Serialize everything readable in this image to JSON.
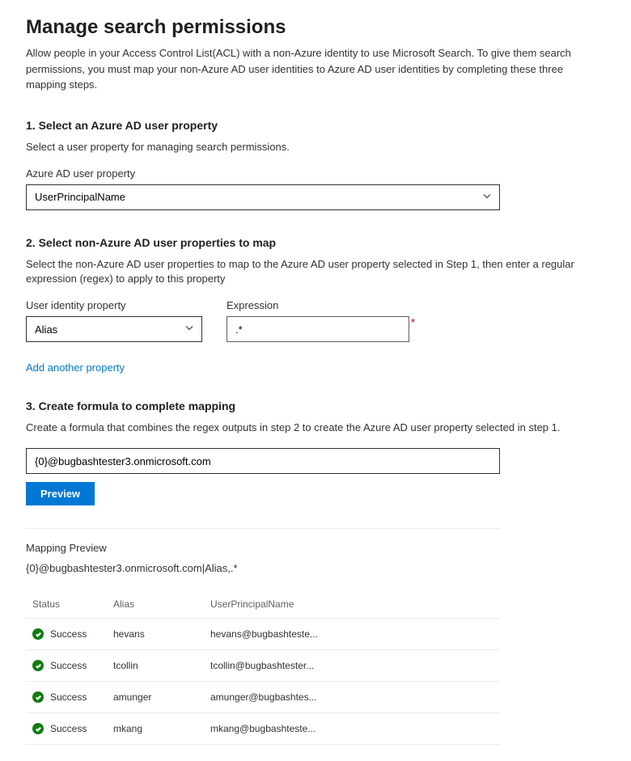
{
  "page": {
    "title": "Manage search permissions",
    "description": "Allow people in your Access Control List(ACL) with a non-Azure identity to use Microsoft Search. To give them search permissions, you must map your non-Azure AD user identities to Azure AD user identities by completing these three mapping steps."
  },
  "step1": {
    "title": "1. Select an Azure AD user property",
    "desc": "Select a user property for managing search permissions.",
    "label": "Azure AD user property",
    "value": "UserPrincipalName"
  },
  "step2": {
    "title": "2. Select non-Azure AD user properties to map",
    "desc": "Select the non-Azure AD user properties to map to the Azure AD user property selected in Step 1, then enter a regular expression (regex) to apply to this property",
    "identity_label": "User identity property",
    "identity_value": "Alias",
    "expression_label": "Expression",
    "expression_value": ".*",
    "add_link": "Add another property"
  },
  "step3": {
    "title": "3. Create formula to complete mapping",
    "desc": "Create a formula that combines the regex outputs in step 2 to create the Azure AD user property selected in step 1.",
    "formula_value": "{0}@bugbashtester3.onmicrosoft.com",
    "preview_button": "Preview"
  },
  "preview": {
    "title": "Mapping Preview",
    "formula_display": "{0}@bugbashtester3.onmicrosoft.com|Alias,.*",
    "columns": {
      "status": "Status",
      "alias": "Alias",
      "upn": "UserPrincipalName"
    },
    "rows": [
      {
        "status": "Success",
        "alias": "hevans",
        "upn": "hevans@bugbashteste..."
      },
      {
        "status": "Success",
        "alias": "tcollin",
        "upn": "tcollin@bugbashtester..."
      },
      {
        "status": "Success",
        "alias": "amunger",
        "upn": "amunger@bugbashtes..."
      },
      {
        "status": "Success",
        "alias": "mkang",
        "upn": "mkang@bugbashteste..."
      }
    ]
  }
}
